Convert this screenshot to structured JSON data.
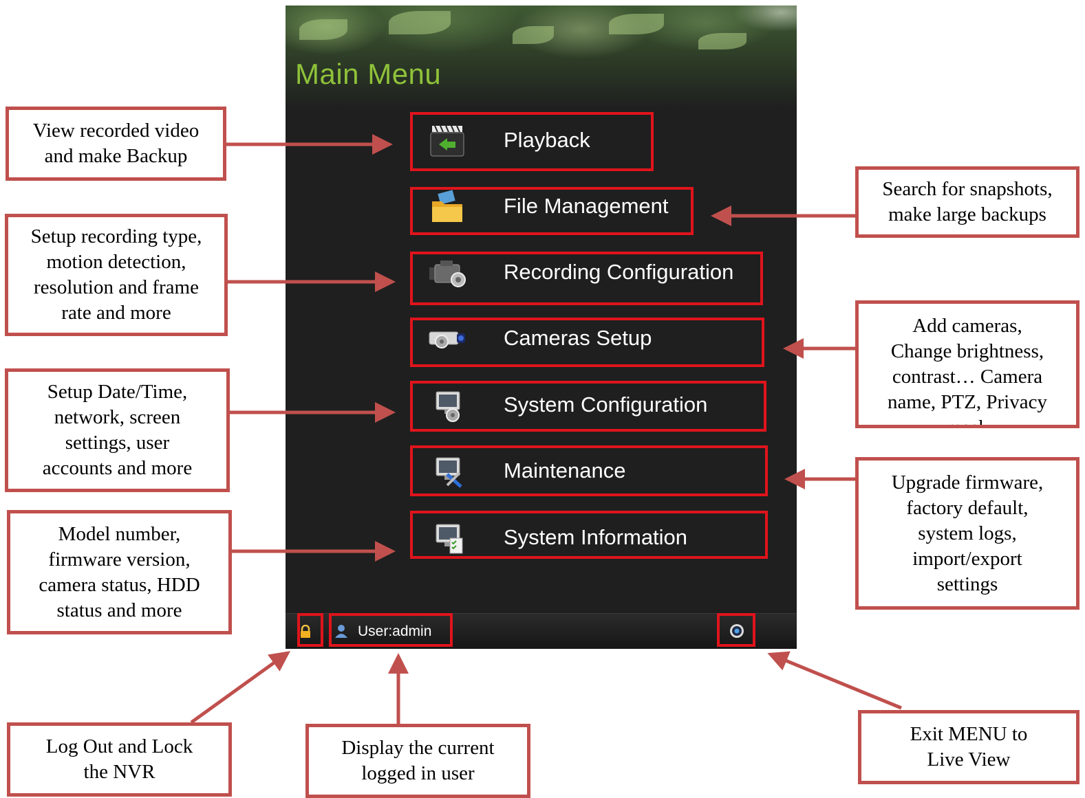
{
  "window": {
    "title": "Main Menu",
    "menu_items": [
      {
        "label": "Playback",
        "icon": "playback-clapper-icon"
      },
      {
        "label": "File Management",
        "icon": "folder-icon"
      },
      {
        "label": "Recording Configuration",
        "icon": "video-camera-gear-icon"
      },
      {
        "label": "Cameras Setup",
        "icon": "camera-gear-icon"
      },
      {
        "label": "System Configuration",
        "icon": "monitor-gear-icon"
      },
      {
        "label": "Maintenance",
        "icon": "monitor-tools-icon"
      },
      {
        "label": "System Information",
        "icon": "monitor-checklist-icon"
      }
    ],
    "status_bar": {
      "user_label": "User:admin",
      "lock_icon": "lock-icon",
      "user_icon": "user-icon",
      "exit_icon": "exit-live-view-icon"
    }
  },
  "annotations": {
    "playback": "View recorded video\nand make Backup",
    "file_management": "Search for snapshots,\nmake large backups",
    "recording": "Setup recording type,\nmotion detection,\nresolution and frame\nrate and more",
    "cameras": "Add cameras,\nChange brightness,\ncontrast… Camera\nname, PTZ, Privacy\nmask",
    "system_config": "Setup Date/Time,\nnetwork, screen\nsettings, user\naccounts and more",
    "maintenance": "Upgrade firmware,\nfactory default,\nsystem logs,\nimport/export\nsettings",
    "system_info": "Model number,\nfirmware version,\ncamera status, HDD\nstatus and more",
    "lock": "Log Out and Lock\nthe NVR",
    "user": "Display the current\nlogged in user",
    "exit": "Exit MENU to\nLive View"
  },
  "colors": {
    "title_green": "#8fc23a",
    "highlight_red": "#e0141c",
    "annotation_border": "#c0504d",
    "panel_bg": "#1f1f1f"
  }
}
